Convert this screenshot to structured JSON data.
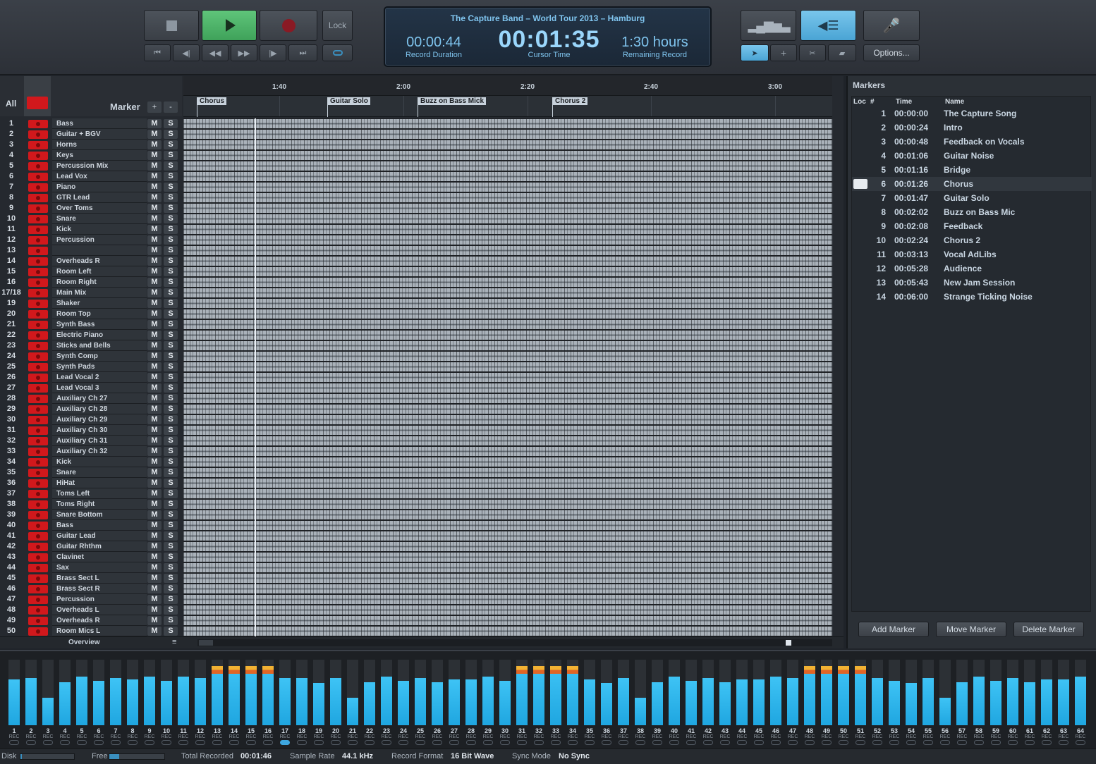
{
  "transport": {
    "lock_label": "Lock",
    "options_label": "Options..."
  },
  "display": {
    "song_title": "The Capture Band – World Tour 2013 – Hamburg",
    "record_duration": "00:00:44",
    "record_duration_caption": "Record Duration",
    "cursor_time": "00:01:35",
    "cursor_time_caption": "Cursor Time",
    "remaining_record": "1:30 hours",
    "remaining_record_caption": "Remaining Record"
  },
  "track_header": {
    "all_label": "All",
    "marker_label": "Marker",
    "add_label": "+",
    "remove_label": "-"
  },
  "ruler_ticks": [
    "1:40",
    "2:00",
    "2:20",
    "2:40",
    "3:00"
  ],
  "marker_flags": [
    "Chorus",
    "Guitar Solo",
    "Buzz on Bass Mick",
    "Chorus 2"
  ],
  "tracks": [
    {
      "num": "1",
      "name": "Bass"
    },
    {
      "num": "2",
      "name": "Guitar + BGV"
    },
    {
      "num": "3",
      "name": "Horns"
    },
    {
      "num": "4",
      "name": "Keys"
    },
    {
      "num": "5",
      "name": "Percussion Mix"
    },
    {
      "num": "6",
      "name": "Lead Vox"
    },
    {
      "num": "7",
      "name": "Piano"
    },
    {
      "num": "8",
      "name": "GTR Lead"
    },
    {
      "num": "9",
      "name": "Over Toms"
    },
    {
      "num": "10",
      "name": "Snare"
    },
    {
      "num": "11",
      "name": "Kick"
    },
    {
      "num": "12",
      "name": "Percussion"
    },
    {
      "num": "13",
      "name": ""
    },
    {
      "num": "14",
      "name": "Overheads R"
    },
    {
      "num": "15",
      "name": "Room Left"
    },
    {
      "num": "16",
      "name": "Room Right"
    },
    {
      "num": "17/18",
      "name": "Main Mix"
    },
    {
      "num": "19",
      "name": "Shaker"
    },
    {
      "num": "20",
      "name": "Room Top"
    },
    {
      "num": "21",
      "name": "Synth Bass"
    },
    {
      "num": "22",
      "name": "Electric Piano"
    },
    {
      "num": "23",
      "name": "Sticks and Bells"
    },
    {
      "num": "24",
      "name": "Synth Comp"
    },
    {
      "num": "25",
      "name": "Synth Pads"
    },
    {
      "num": "26",
      "name": "Lead Vocal 2"
    },
    {
      "num": "27",
      "name": "Lead Vocal 3"
    },
    {
      "num": "28",
      "name": "Auxiliary Ch 27"
    },
    {
      "num": "29",
      "name": "Auxiliary Ch 28"
    },
    {
      "num": "30",
      "name": "Auxiliary Ch 29"
    },
    {
      "num": "31",
      "name": "Auxiliary Ch 30"
    },
    {
      "num": "32",
      "name": "Auxiliary Ch 31"
    },
    {
      "num": "33",
      "name": "Auxiliary Ch 32"
    },
    {
      "num": "34",
      "name": "Kick"
    },
    {
      "num": "35",
      "name": "Snare"
    },
    {
      "num": "36",
      "name": "HiHat"
    },
    {
      "num": "37",
      "name": "Toms Left"
    },
    {
      "num": "38",
      "name": "Toms Right"
    },
    {
      "num": "39",
      "name": "Snare Bottom"
    },
    {
      "num": "40",
      "name": "Bass"
    },
    {
      "num": "41",
      "name": "Guitar Lead"
    },
    {
      "num": "42",
      "name": "Guitar Rhthm"
    },
    {
      "num": "43",
      "name": "Clavinet"
    },
    {
      "num": "44",
      "name": "Sax"
    },
    {
      "num": "45",
      "name": "Brass Sect L"
    },
    {
      "num": "46",
      "name": "Brass Sect R"
    },
    {
      "num": "47",
      "name": "Percussion"
    },
    {
      "num": "48",
      "name": "Overheads L"
    },
    {
      "num": "49",
      "name": "Overheads R"
    },
    {
      "num": "50",
      "name": "Room Mics L"
    }
  ],
  "mute_label": "M",
  "solo_label": "S",
  "overview_label": "Overview",
  "overview_menu_icon": "≡",
  "markers_panel": {
    "title": "Markers",
    "col_loc": "Loc",
    "col_num": "#",
    "col_time": "Time",
    "col_name": "Name",
    "rows": [
      {
        "idx": "1",
        "time": "00:00:00",
        "name": "The Capture Song"
      },
      {
        "idx": "2",
        "time": "00:00:24",
        "name": "Intro"
      },
      {
        "idx": "3",
        "time": "00:00:48",
        "name": "Feedback on Vocals"
      },
      {
        "idx": "4",
        "time": "00:01:06",
        "name": "Guitar Noise"
      },
      {
        "idx": "5",
        "time": "00:01:16",
        "name": "Bridge"
      },
      {
        "idx": "6",
        "time": "00:01:26",
        "name": "Chorus"
      },
      {
        "idx": "7",
        "time": "00:01:47",
        "name": "Guitar Solo"
      },
      {
        "idx": "8",
        "time": "00:02:02",
        "name": "Buzz on Bass Mic"
      },
      {
        "idx": "9",
        "time": "00:02:08",
        "name": "Feedback"
      },
      {
        "idx": "10",
        "time": "00:02:24",
        "name": "Chorus 2"
      },
      {
        "idx": "11",
        "time": "00:03:13",
        "name": "Vocal AdLibs"
      },
      {
        "idx": "12",
        "time": "00:05:28",
        "name": "Audience"
      },
      {
        "idx": "13",
        "time": "00:05:43",
        "name": "New Jam Session"
      },
      {
        "idx": "14",
        "time": "00:06:00",
        "name": "Strange Ticking Noise"
      }
    ],
    "add_label": "Add Marker",
    "move_label": "Move Marker",
    "delete_label": "Delete Marker"
  },
  "meters": {
    "rec_label": "REC",
    "levels": [
      0.7,
      0.72,
      0.42,
      0.66,
      0.74,
      0.68,
      0.72,
      0.7,
      0.74,
      0.68,
      0.74,
      0.72,
      0.9,
      0.9,
      0.9,
      0.9,
      0.72,
      0.72,
      0.64,
      0.72,
      0.42,
      0.66,
      0.74,
      0.68,
      0.72,
      0.66,
      0.7,
      0.7,
      0.74,
      0.68,
      0.9,
      0.9,
      0.9,
      0.9,
      0.7,
      0.64,
      0.72,
      0.42,
      0.66,
      0.74,
      0.68,
      0.72,
      0.66,
      0.7,
      0.7,
      0.74,
      0.72,
      0.9,
      0.9,
      0.9,
      0.9,
      0.72,
      0.68,
      0.64,
      0.72,
      0.42,
      0.66,
      0.74,
      0.68,
      0.72,
      0.66,
      0.7,
      0.7,
      0.74
    ],
    "peaks": [
      13,
      14,
      15,
      16,
      31,
      32,
      33,
      34,
      48,
      49,
      50,
      51
    ],
    "linked": [
      17
    ]
  },
  "status": {
    "disk_label": "Disk",
    "disk_fraction": 0.03,
    "free_label": "Free",
    "free_fraction": 0.18,
    "total_recorded_label": "Total Recorded",
    "total_recorded": "00:01:46",
    "sample_rate_label": "Sample Rate",
    "sample_rate": "44.1 kHz",
    "record_format_label": "Record Format",
    "record_format": "16 Bit Wave",
    "sync_mode_label": "Sync Mode",
    "sync_mode": "No Sync"
  },
  "colors": {
    "record_red": "#d1181c",
    "play_green": "#4fb86a",
    "accent_blue": "#3ec3f5",
    "display_text": "#7fc4ee"
  }
}
